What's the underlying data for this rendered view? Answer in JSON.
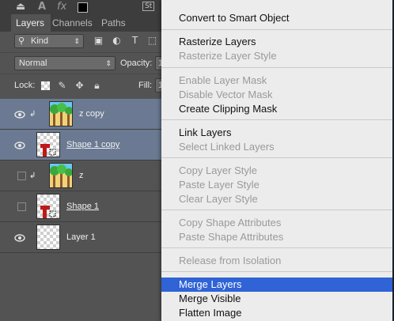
{
  "toolbar": {
    "icons": [
      "stamp-icon",
      "a-icon",
      "fx-icon",
      "swatch-icon",
      "st-icon"
    ],
    "fx": "fx",
    "a": "A",
    "st": "St"
  },
  "tabs": [
    {
      "label": "Layers",
      "active": true
    },
    {
      "label": "Channels",
      "active": false
    },
    {
      "label": "Paths",
      "active": false
    }
  ],
  "filter": {
    "kind": "Kind"
  },
  "blend": {
    "mode": "Normal",
    "opacity_label": "Opacity:",
    "opacity_value": "1"
  },
  "lock": {
    "label": "Lock:",
    "fill_label": "Fill:",
    "fill_value": "1"
  },
  "layers": [
    {
      "name": "z copy",
      "visible": true,
      "selected": true,
      "clipped": true,
      "thumb": "image"
    },
    {
      "name": "Shape 1 copy",
      "visible": true,
      "selected": true,
      "clipped": false,
      "thumb": "shape"
    },
    {
      "name": "z",
      "visible": false,
      "selected": false,
      "clipped": true,
      "thumb": "image"
    },
    {
      "name": "Shape 1",
      "visible": false,
      "selected": false,
      "clipped": false,
      "thumb": "shape"
    },
    {
      "name": "Layer 1",
      "visible": true,
      "selected": false,
      "clipped": false,
      "thumb": "empty"
    }
  ],
  "menu": {
    "items": [
      {
        "label": "Convert to Smart Object",
        "enabled": true
      },
      {
        "label": "Rasterize Layers",
        "enabled": true
      },
      {
        "label": "Rasterize Layer Style",
        "enabled": false
      },
      {
        "label": "Enable Layer Mask",
        "enabled": false
      },
      {
        "label": "Disable Vector Mask",
        "enabled": false
      },
      {
        "label": "Create Clipping Mask",
        "enabled": true
      },
      {
        "label": "Link Layers",
        "enabled": true
      },
      {
        "label": "Select Linked Layers",
        "enabled": false
      },
      {
        "label": "Copy Layer Style",
        "enabled": false
      },
      {
        "label": "Paste Layer Style",
        "enabled": false
      },
      {
        "label": "Clear Layer Style",
        "enabled": false
      },
      {
        "label": "Copy Shape Attributes",
        "enabled": false
      },
      {
        "label": "Paste Shape Attributes",
        "enabled": false
      },
      {
        "label": "Release from Isolation",
        "enabled": false
      },
      {
        "label": "Merge Layers",
        "enabled": true,
        "highlighted": true
      },
      {
        "label": "Merge Visible",
        "enabled": true
      },
      {
        "label": "Flatten Image",
        "enabled": true
      }
    ]
  },
  "colors": {
    "selection": "#6b7a92",
    "menu_highlight": "#2f63d6",
    "panel": "#535353"
  }
}
